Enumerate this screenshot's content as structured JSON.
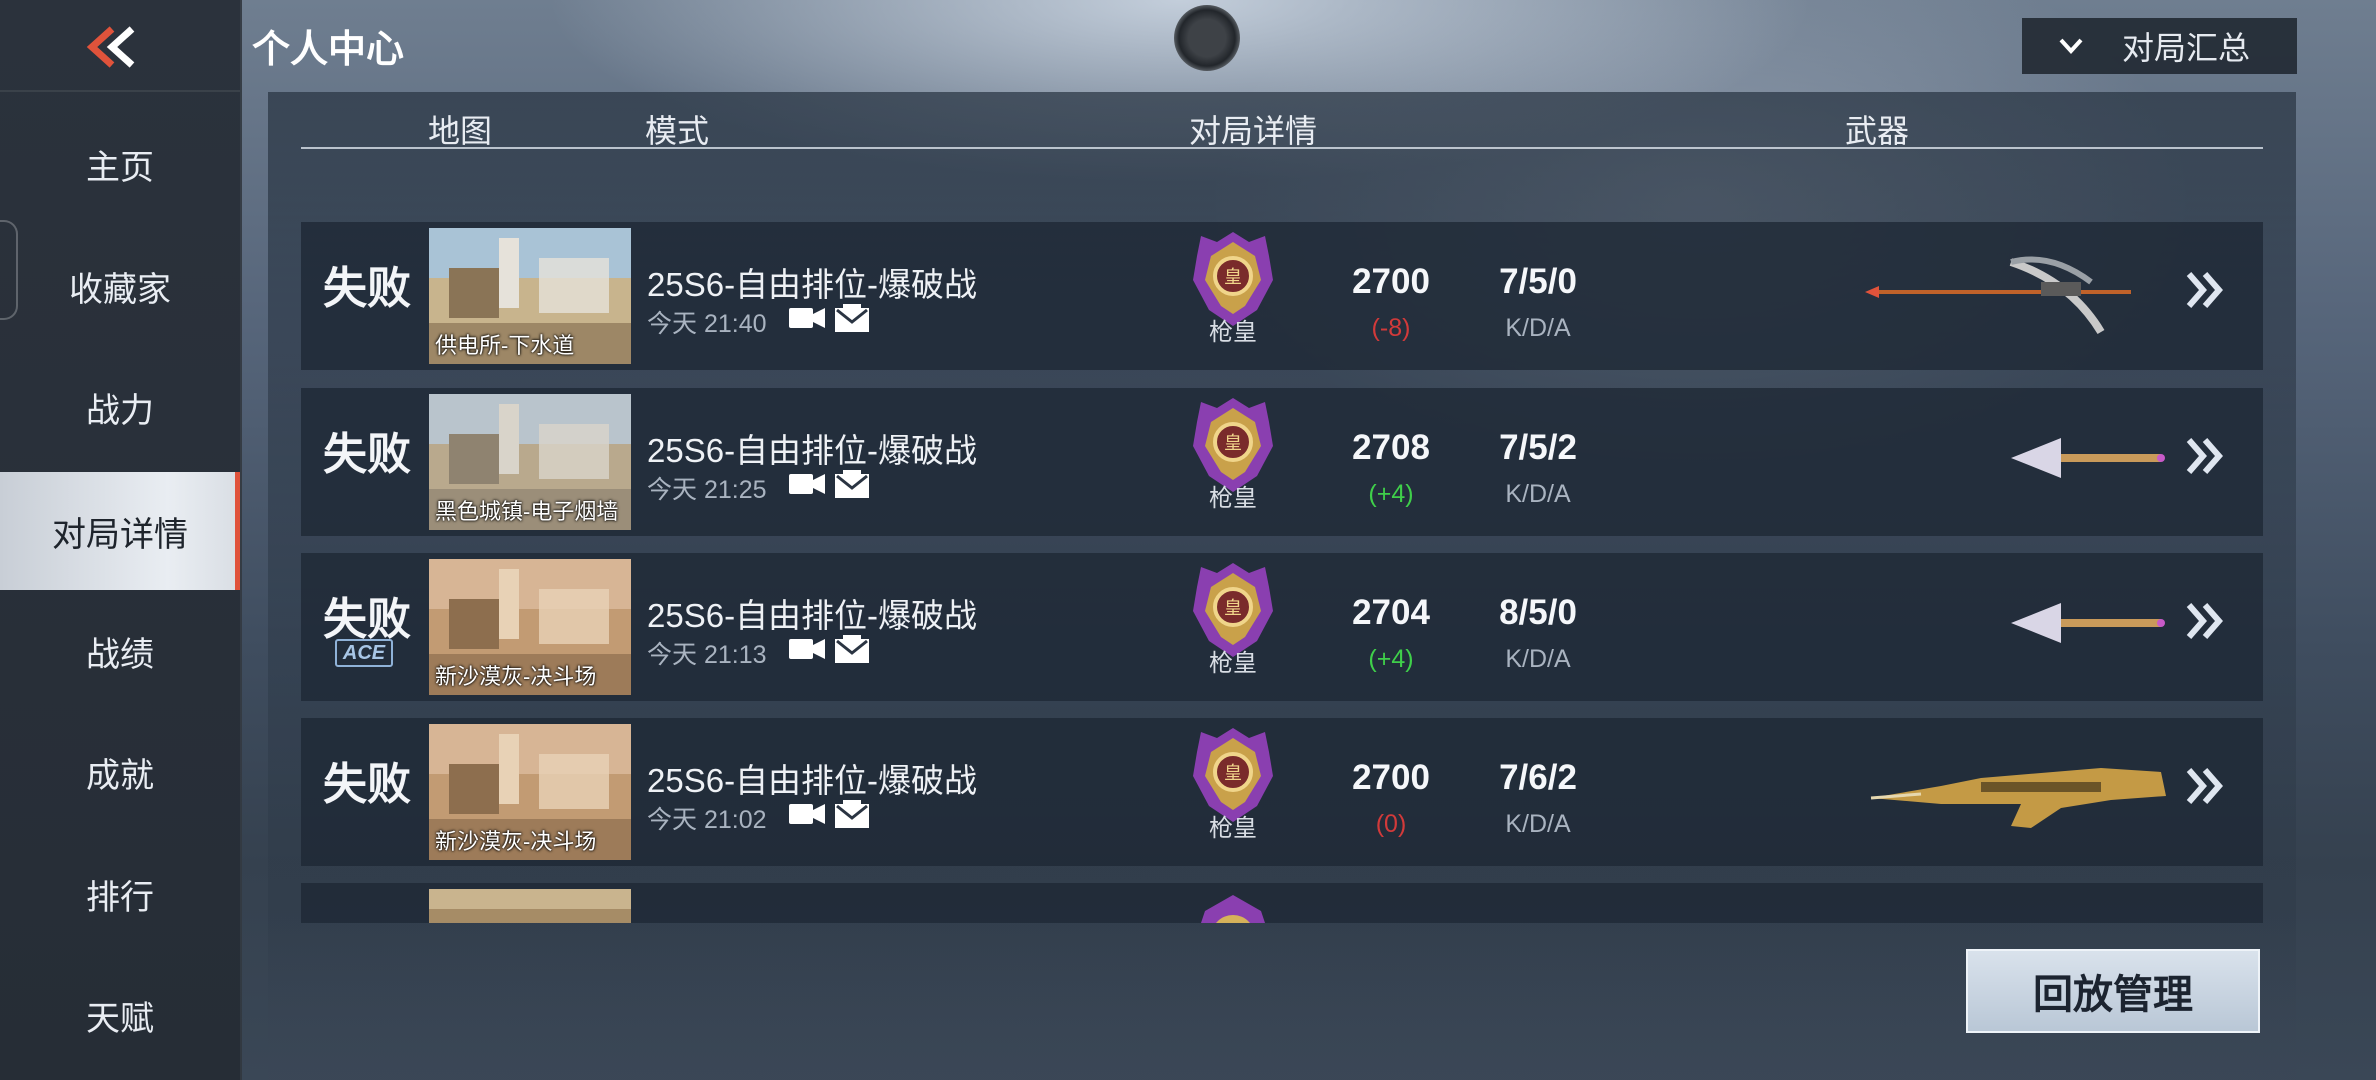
{
  "sidebar": {
    "items": [
      {
        "label": "主页",
        "active": false
      },
      {
        "label": "收藏家",
        "active": false
      },
      {
        "label": "战力",
        "active": false
      },
      {
        "label": "对局详情",
        "active": true
      },
      {
        "label": "战绩",
        "active": false
      },
      {
        "label": "成就",
        "active": false
      },
      {
        "label": "排行",
        "active": false
      },
      {
        "label": "天赋",
        "active": false
      }
    ]
  },
  "header": {
    "title": "个人中心",
    "summary_label": "对局汇总"
  },
  "table": {
    "columns": {
      "map": "地图",
      "mode": "模式",
      "details": "对局详情",
      "weapon": "武器"
    },
    "kda_label": "K/D/A",
    "rows": [
      {
        "result": "失败",
        "ace": "",
        "map": "供电所-下水道",
        "mode": "25S6-自由排位-爆破战",
        "time": "今天 21:40",
        "rank": "枪皇",
        "score": "2700",
        "delta": "(-8)",
        "delta_color": "#d23a3a",
        "kda": "7/5/0",
        "weapon_icon": "bow-weapon-icon"
      },
      {
        "result": "失败",
        "ace": "",
        "map": "黑色城镇-电子烟墙",
        "mode": "25S6-自由排位-爆破战",
        "time": "今天 21:25",
        "rank": "枪皇",
        "score": "2708",
        "delta": "(+4)",
        "delta_color": "#3fcf4a",
        "kda": "7/5/2",
        "weapon_icon": "horn-weapon-icon"
      },
      {
        "result": "失败",
        "ace": "ACE",
        "map": "新沙漠灰-决斗场",
        "mode": "25S6-自由排位-爆破战",
        "time": "今天 21:13",
        "rank": "枪皇",
        "score": "2704",
        "delta": "(+4)",
        "delta_color": "#3fcf4a",
        "kda": "8/5/0",
        "weapon_icon": "horn-weapon-icon"
      },
      {
        "result": "失败",
        "ace": "",
        "map": "新沙漠灰-决斗场",
        "mode": "25S6-自由排位-爆破战",
        "time": "今天 21:02",
        "rank": "枪皇",
        "score": "2700",
        "delta": "(0)",
        "delta_color": "#d23a3a",
        "kda": "7/6/2",
        "weapon_icon": "golden-rifle-weapon-icon"
      }
    ]
  },
  "replay_button": "回放管理",
  "colors": {
    "accent_red": "#e0533b",
    "win_green": "#3fcf4a",
    "loss_red": "#d23a3a"
  }
}
